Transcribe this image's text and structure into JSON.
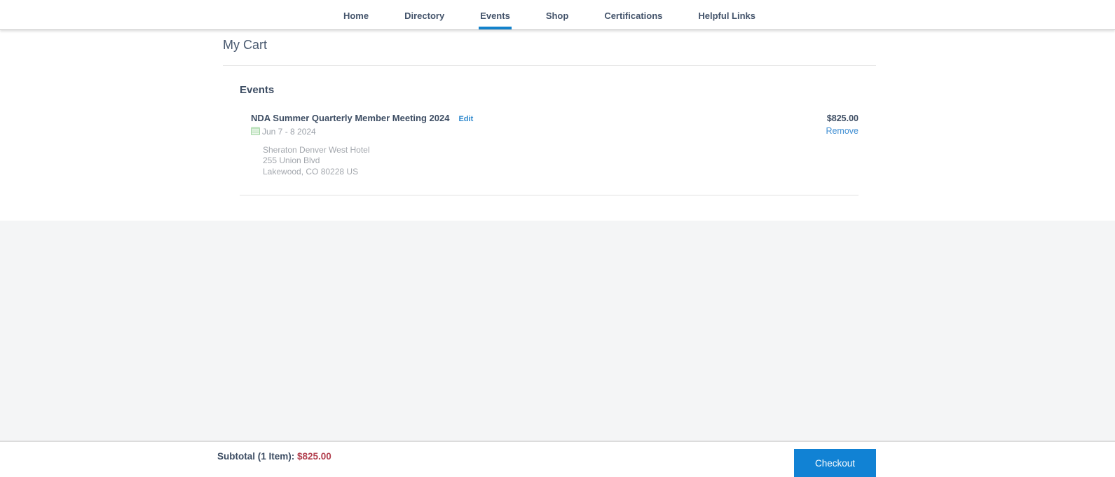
{
  "nav": {
    "items": [
      {
        "label": "Home",
        "active": false
      },
      {
        "label": "Directory",
        "active": false
      },
      {
        "label": "Events",
        "active": true
      },
      {
        "label": "Shop",
        "active": false
      },
      {
        "label": "Certifications",
        "active": false
      },
      {
        "label": "Helpful Links",
        "active": false
      }
    ]
  },
  "page": {
    "title": "My Cart"
  },
  "cart": {
    "section_title": "Events",
    "items": [
      {
        "name": "NDA Summer Quarterly Member Meeting 2024",
        "edit_label": "Edit",
        "date": "Jun 7 - 8 2024",
        "venue": "Sheraton Denver West Hotel",
        "address_line1": "255 Union Blvd",
        "address_line2": "Lakewood, CO 80228 US",
        "price": "$825.00",
        "remove_label": "Remove"
      }
    ]
  },
  "footer": {
    "subtotal_label": "Subtotal (1 Item): ",
    "subtotal_value": "$825.00",
    "checkout_label": "Checkout"
  },
  "icons": {
    "calendar": "calendar-icon"
  },
  "colors": {
    "active_tab_underline": "#1382cb",
    "link_blue": "#2a86cc",
    "remove_blue": "#3f8ed3",
    "subtotal_red": "#b2404f",
    "checkout_blue": "#1182d4",
    "gray_background": "#f4f5f6"
  }
}
